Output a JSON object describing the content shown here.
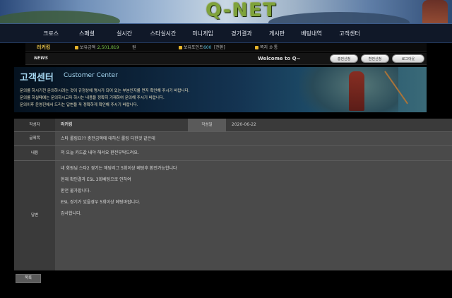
{
  "banner": {
    "logo": "Q-NET"
  },
  "nav": {
    "items": [
      "크로스",
      "스페셜",
      "실시간",
      "스타실시간",
      "미니게임",
      "경기결과",
      "게시판",
      "베팅내역",
      "고객센터"
    ]
  },
  "info": {
    "username": "러커킹",
    "money_label": "보유금액 :",
    "money_value": "2,501,819",
    "money_unit": "원",
    "point_label": "보유포인트 :",
    "point_value": "600",
    "point_unit": "[전환]",
    "note_label": "쪽지 :",
    "note_value": "0 통"
  },
  "newsbar": {
    "news_label": "NEWS",
    "welcome": "Welcome to Q~",
    "buttons": [
      "충전신청",
      "환전신청",
      "로그아웃"
    ]
  },
  "cc": {
    "title": "고객센터",
    "subtitle": "Customer Center",
    "desc1": "문의를 하시기전 문의하시려는 것이 규정상에 명시가 되어 있는 부분인지를 먼저 확인해 주시기 바랍니다.",
    "desc2": "문의를 하실때에는 문의하시고자 하시는 내용을 정확히 기재하여 문의해 주시기 바랍니다.",
    "desc3": "문의이후 운영진에서 드리는 답변을 꼭 정확하게 확인해 주시기 바랍니다."
  },
  "detail": {
    "author_label": "작성자",
    "author_value": "러커킹",
    "date_label": "작성일",
    "date_value": "2020-06-22",
    "subject_label": "글제목",
    "subject_value": "스타 롤링요?? 충전금액에 대하신 롤링 다한것 같은데",
    "content_label": "내용",
    "content_value": "저 오늘 카드값 내야 해서요 환전부탁드려요.",
    "answer_label": "답변",
    "answer_lines": [
      "네 회원님 스타2 경기는 해당리그 5회이상 베팅후 환전가능합니다",
      "현재 확인결과 ESL 3회베팅으로 인하여",
      "환전 불가합니다.",
      "ESL 경기가 있을경우 5회이상 베팅바랍니다.",
      "감사합니다."
    ]
  },
  "back_button": "목록"
}
